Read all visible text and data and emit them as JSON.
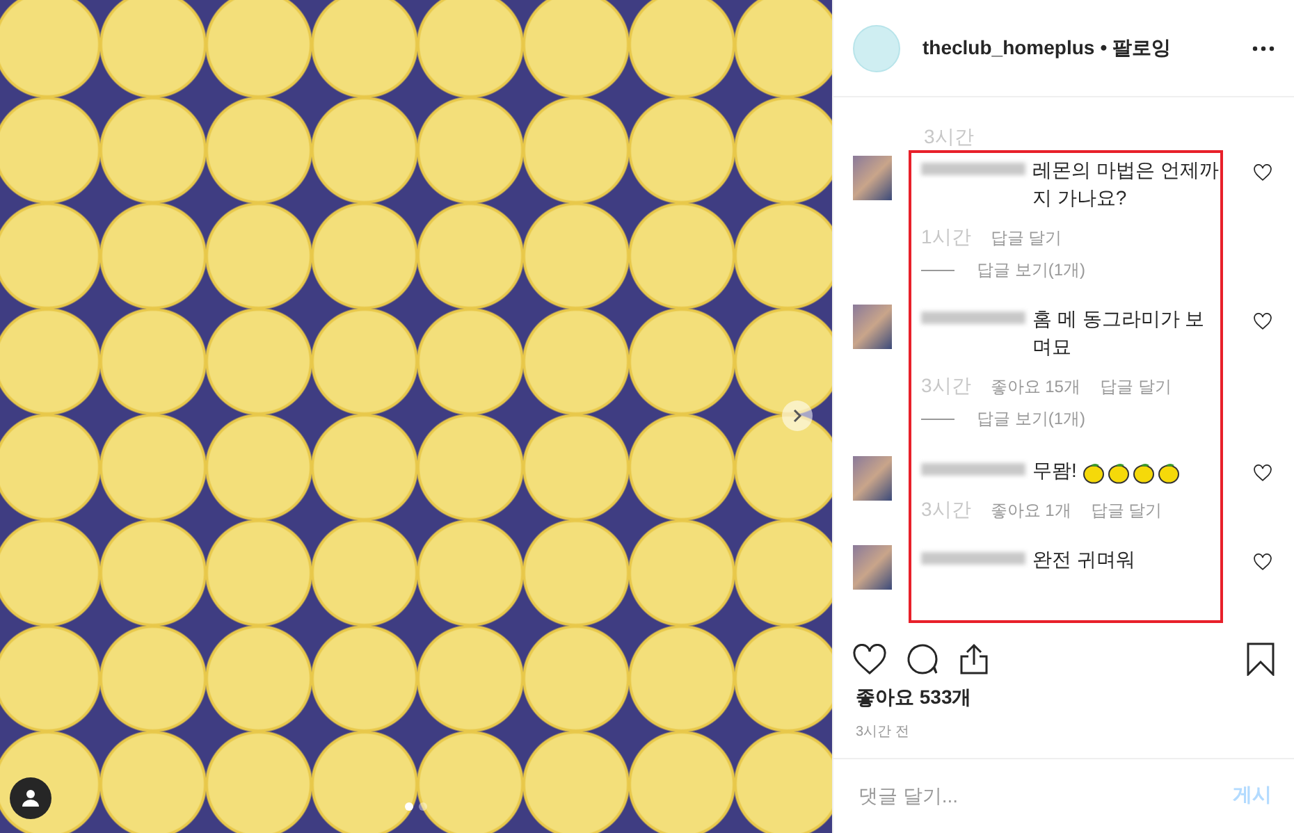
{
  "photo": {
    "carousel_dots": [
      {
        "selected": true
      },
      {
        "selected": false
      }
    ]
  },
  "account": {
    "username": "theclub_homeplus",
    "separator": "•",
    "follow_status": "팔로잉"
  },
  "caption_time": "3시간",
  "comments": [
    {
      "text": "레몬의 마법은 언제까지 가나요?",
      "time": "1시간",
      "reply": "답글 달기",
      "view_replies": "답글 보기(1개)"
    },
    {
      "text": "홈 메 동그라미가 보며묘",
      "time": "3시간",
      "likes": "좋아요 15개",
      "reply": "답글 달기",
      "view_replies": "답글 보기(1개)"
    },
    {
      "text": "무뫔!",
      "emoji": [
        {
          "kind": "lemon"
        },
        {
          "kind": "lemon"
        },
        {
          "kind": "lemon"
        },
        {
          "kind": "lemon"
        }
      ],
      "time": "3시간",
      "likes": "좋아요 1개",
      "reply": "답글 달기"
    },
    {
      "text": "완전 귀며워"
    }
  ],
  "likes": "좋아요 533개",
  "posted": "3시간 전",
  "comment_input": {
    "placeholder": "댓글 달기..."
  },
  "post_button": "게시"
}
